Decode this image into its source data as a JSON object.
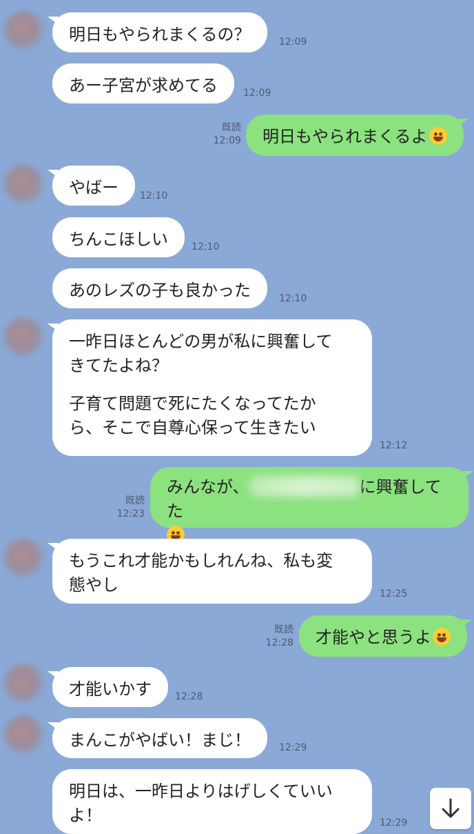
{
  "messages": [
    {
      "side": "them",
      "text": "明日もやられまくるの？",
      "time": "12:09"
    },
    {
      "side": "them",
      "text": "あー子宮が求めてる",
      "time": "12:09"
    },
    {
      "side": "me",
      "text": "明日もやられまくるよ",
      "emoji": "grinning-squinting-face",
      "read": "既読",
      "time": "12:09"
    },
    {
      "side": "them",
      "text": "やばー",
      "time": "12:10"
    },
    {
      "side": "them",
      "text": "ちんこほしい",
      "time": "12:10"
    },
    {
      "side": "them",
      "text": "あのレズの子も良かった",
      "time": "12:10"
    },
    {
      "side": "them",
      "lines": [
        "一昨日ほとんどの男が私に興奮して",
        "きてたよね？",
        "",
        "子育て問題で死にたくなってたか",
        "ら、そこで自尊心保って生きたい"
      ],
      "time": "12:12"
    },
    {
      "side": "me",
      "text_before": "みんなが、",
      "text_after": "に興奮してた",
      "emoji": "grinning-face",
      "read": "既読",
      "time": "12:23"
    },
    {
      "side": "them",
      "lines": [
        "もうこれ才能かもしれんね、私も変",
        "態やし"
      ],
      "time": "12:25"
    },
    {
      "side": "me",
      "text": "才能やと思うよ",
      "emoji": "grinning-squinting-face",
      "read": "既読",
      "time": "12:28"
    },
    {
      "side": "them",
      "text": "才能いかす",
      "time": "12:28"
    },
    {
      "side": "them",
      "text": "まんこがやばい！まじ！",
      "time": "12:29"
    },
    {
      "side": "them",
      "lines": [
        "明日は、一昨日よりはげしくていい",
        "よ！"
      ],
      "time": "12:29"
    }
  ],
  "scroll_button": {
    "icon": "arrow-down-icon"
  },
  "colors": {
    "background": "#8aa9d6",
    "bubble_them": "#ffffff",
    "bubble_me": "#8be27f"
  }
}
